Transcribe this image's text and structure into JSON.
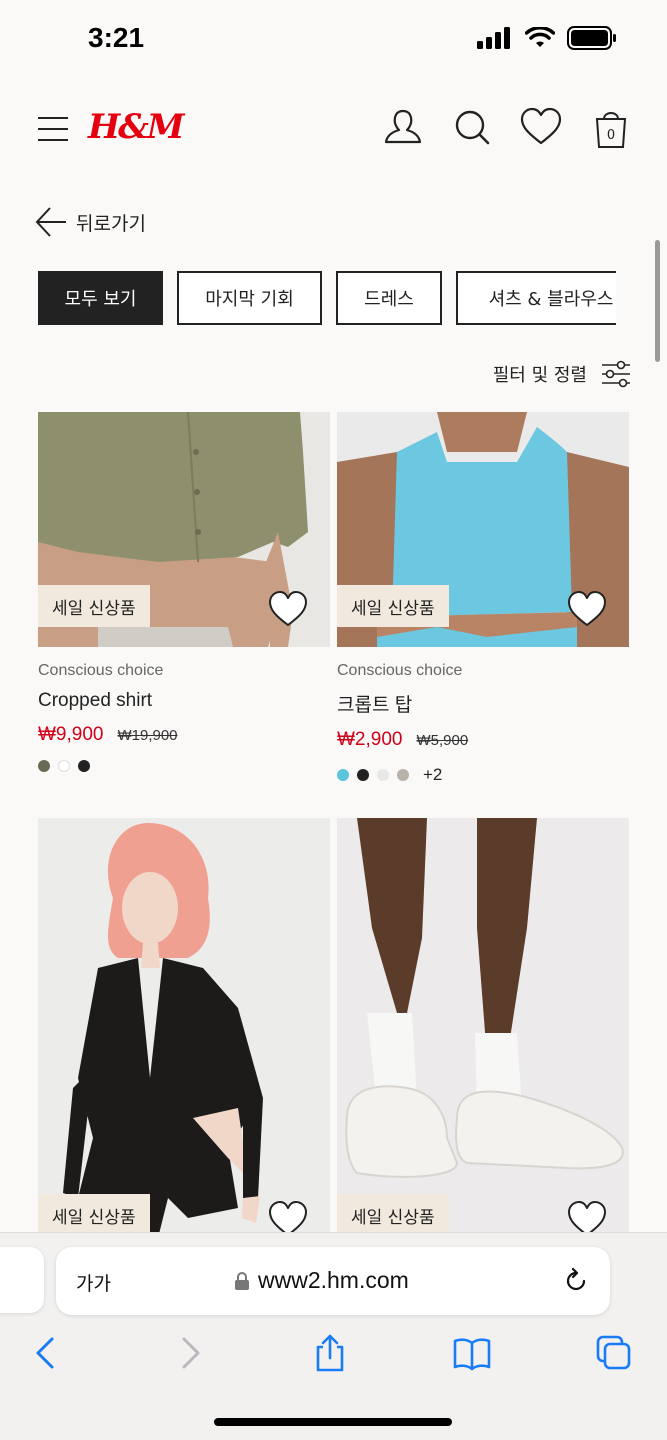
{
  "status": {
    "time": "3:21"
  },
  "header": {
    "logo": "H&M",
    "bag_count": "0"
  },
  "back": {
    "label": "뒤로가기"
  },
  "chips": [
    "모두 보기",
    "마지막 기회",
    "드레스",
    "셔츠 & 블라우스"
  ],
  "filter": {
    "label": "필터 및 정렬"
  },
  "products": [
    {
      "badge": "세일 신상품",
      "tag": "Conscious choice",
      "name": "Cropped shirt",
      "price": "₩9,900",
      "old_price": "₩19,900",
      "swatches": [
        "#6b6a55",
        "#ffffff",
        "#222222"
      ],
      "more": ""
    },
    {
      "badge": "세일 신상품",
      "tag": "Conscious choice",
      "name": "크롭트 탑",
      "price": "₩2,900",
      "old_price": "₩5,900",
      "swatches": [
        "#5bc3dc",
        "#222222",
        "#e8e8e8",
        "#b9b2ab"
      ],
      "more": "+2"
    },
    {
      "badge": "세일 신상품"
    },
    {
      "badge": "세일 신상품"
    }
  ],
  "browser": {
    "aa": "가가",
    "url": "www2.hm.com"
  },
  "colors": {
    "brand": "#e50010",
    "sale": "#d0021b",
    "badge_bg": "#f1e9dd",
    "ios_blue": "#1a7cf5"
  }
}
